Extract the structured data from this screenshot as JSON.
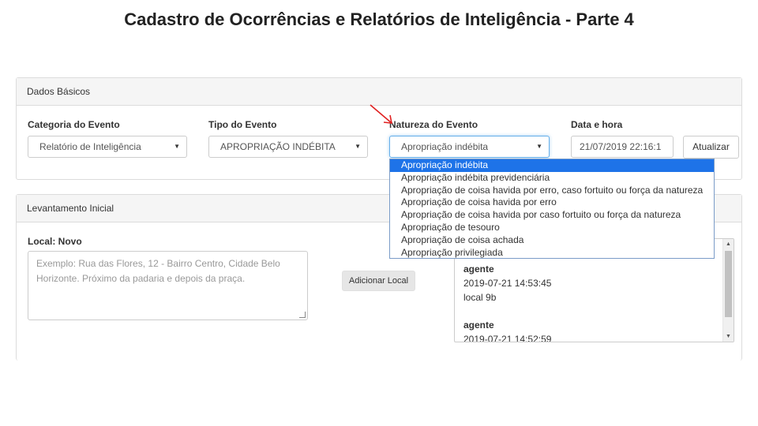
{
  "slide_title": "Cadastro de Ocorrências e Relatórios de Inteligência - Parte 4",
  "dados_basicos": {
    "heading": "Dados Básicos",
    "categoria": {
      "label": "Categoria do Evento",
      "value": "Relatório de Inteligência"
    },
    "tipo": {
      "label": "Tipo do Evento",
      "value": "APROPRIAÇÃO INDÉBITA"
    },
    "natureza": {
      "label": "Natureza do Evento",
      "value": "Apropriação indébita",
      "options": [
        "Apropriação indébita",
        "Apropriação indébita previdenciária",
        "Apropriação de coisa havida por erro, caso fortuito ou força da natureza",
        "Apropriação de coisa havida por erro",
        "Apropriação de coisa havida por caso fortuito ou força da natureza",
        "Apropriação de tesouro",
        "Apropriação de coisa achada",
        "Apropriação privilegiada"
      ]
    },
    "data_hora": {
      "label": "Data e hora",
      "value": "21/07/2019 22:16:1"
    },
    "atualizar_label": "Atualizar"
  },
  "levantamento": {
    "heading": "Levantamento Inicial",
    "local_label": "Local: Novo",
    "local_placeholder": "Exemplo: Rua das Flores, 12 - Bairro Centro, Cidade Belo Horizonte. Próximo da padaria e depois da praça.",
    "adicionar_label": "Adicionar Local",
    "log": [
      {
        "who": "agente",
        "when": "2019-07-21 14:53:45",
        "what": "local 9b"
      },
      {
        "who": "agente",
        "when": "2019-07-21 14:52:59"
      }
    ]
  },
  "colors": {
    "accent": "#1e73e8",
    "arrow": "#e02020",
    "panel_heading_bg": "#f5f5f5"
  }
}
